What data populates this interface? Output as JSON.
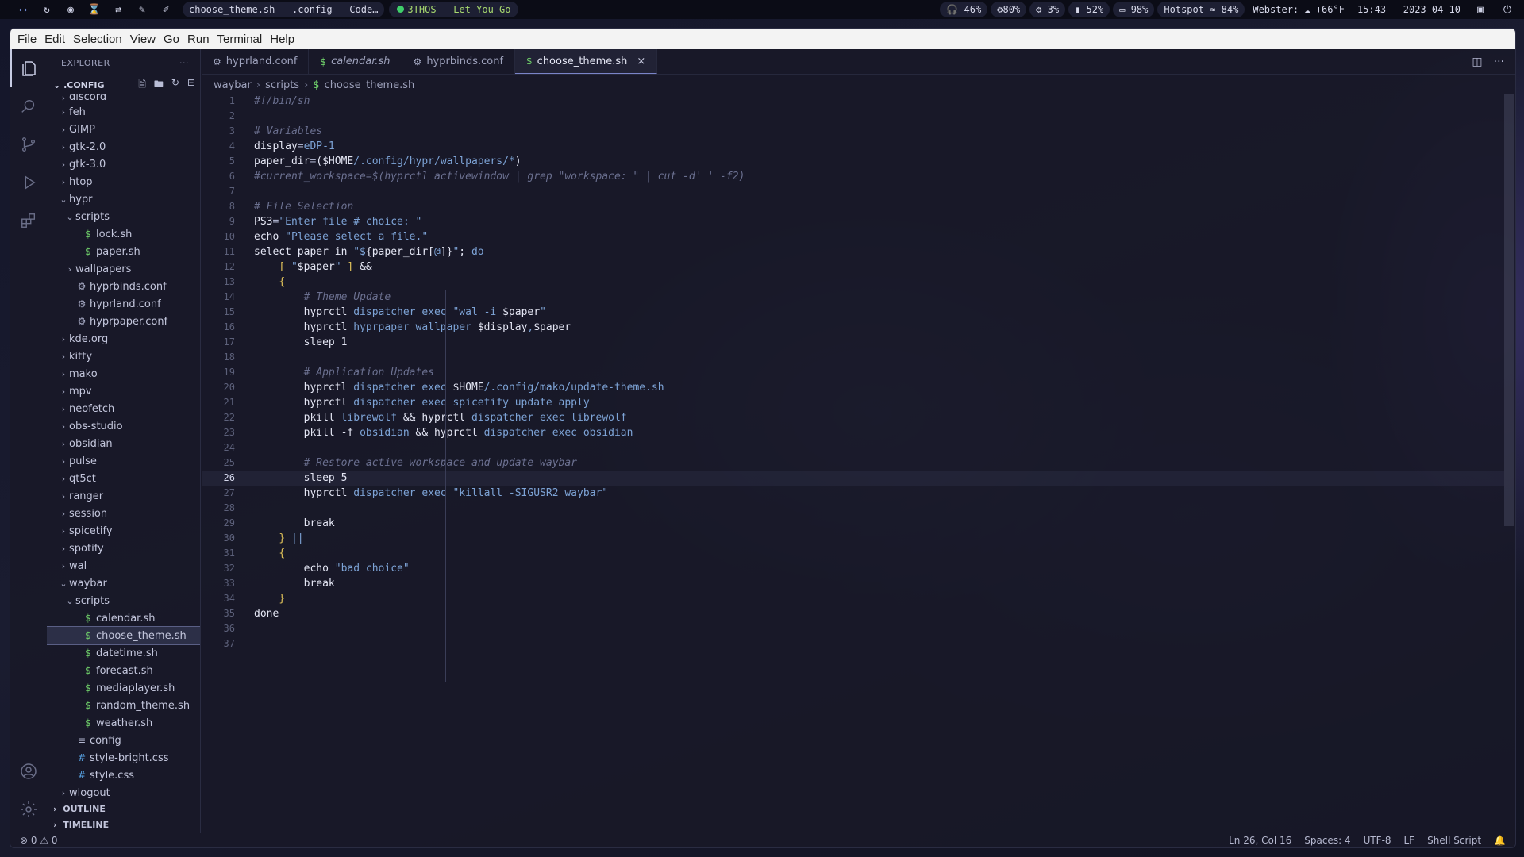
{
  "topbar": {
    "window_title": "choose_theme.sh - .config - Code…",
    "music": "3THOS - Let You Go",
    "pills": [
      "46%",
      "80%",
      "3%",
      "52%",
      "98%"
    ],
    "hotspot": "Hotspot",
    "wifi": "84%",
    "weather": "Webster: ☁ +66°F",
    "datetime": "15:43 - 2023-04-10"
  },
  "menubar": [
    "File",
    "Edit",
    "Selection",
    "View",
    "Go",
    "Run",
    "Terminal",
    "Help"
  ],
  "sidebar": {
    "header": "EXPLORER",
    "more": "···",
    "root": ".CONFIG",
    "items": [
      {
        "label": "discord",
        "depth": 0,
        "kind": "folder",
        "open": false
      },
      {
        "label": "feh",
        "depth": 0,
        "kind": "folder",
        "open": false
      },
      {
        "label": "GIMP",
        "depth": 0,
        "kind": "folder",
        "open": false
      },
      {
        "label": "gtk-2.0",
        "depth": 0,
        "kind": "folder",
        "open": false
      },
      {
        "label": "gtk-3.0",
        "depth": 0,
        "kind": "folder",
        "open": false
      },
      {
        "label": "htop",
        "depth": 0,
        "kind": "folder",
        "open": false
      },
      {
        "label": "hypr",
        "depth": 0,
        "kind": "folder",
        "open": true
      },
      {
        "label": "scripts",
        "depth": 1,
        "kind": "folder",
        "open": true
      },
      {
        "label": "lock.sh",
        "depth": 2,
        "kind": "sh"
      },
      {
        "label": "paper.sh",
        "depth": 2,
        "kind": "sh"
      },
      {
        "label": "wallpapers",
        "depth": 1,
        "kind": "folder",
        "open": false
      },
      {
        "label": "hyprbinds.conf",
        "depth": 1,
        "kind": "conf"
      },
      {
        "label": "hyprland.conf",
        "depth": 1,
        "kind": "conf"
      },
      {
        "label": "hyprpaper.conf",
        "depth": 1,
        "kind": "conf"
      },
      {
        "label": "kde.org",
        "depth": 0,
        "kind": "folder",
        "open": false
      },
      {
        "label": "kitty",
        "depth": 0,
        "kind": "folder",
        "open": false
      },
      {
        "label": "mako",
        "depth": 0,
        "kind": "folder",
        "open": false
      },
      {
        "label": "mpv",
        "depth": 0,
        "kind": "folder",
        "open": false
      },
      {
        "label": "neofetch",
        "depth": 0,
        "kind": "folder",
        "open": false
      },
      {
        "label": "obs-studio",
        "depth": 0,
        "kind": "folder",
        "open": false
      },
      {
        "label": "obsidian",
        "depth": 0,
        "kind": "folder",
        "open": false
      },
      {
        "label": "pulse",
        "depth": 0,
        "kind": "folder",
        "open": false
      },
      {
        "label": "qt5ct",
        "depth": 0,
        "kind": "folder",
        "open": false
      },
      {
        "label": "ranger",
        "depth": 0,
        "kind": "folder",
        "open": false
      },
      {
        "label": "session",
        "depth": 0,
        "kind": "folder",
        "open": false
      },
      {
        "label": "spicetify",
        "depth": 0,
        "kind": "folder",
        "open": false
      },
      {
        "label": "spotify",
        "depth": 0,
        "kind": "folder",
        "open": false
      },
      {
        "label": "wal",
        "depth": 0,
        "kind": "folder",
        "open": false
      },
      {
        "label": "waybar",
        "depth": 0,
        "kind": "folder",
        "open": true
      },
      {
        "label": "scripts",
        "depth": 1,
        "kind": "folder",
        "open": true
      },
      {
        "label": "calendar.sh",
        "depth": 2,
        "kind": "sh"
      },
      {
        "label": "choose_theme.sh",
        "depth": 2,
        "kind": "sh",
        "selected": true
      },
      {
        "label": "datetime.sh",
        "depth": 2,
        "kind": "sh"
      },
      {
        "label": "forecast.sh",
        "depth": 2,
        "kind": "sh"
      },
      {
        "label": "mediaplayer.sh",
        "depth": 2,
        "kind": "sh"
      },
      {
        "label": "random_theme.sh",
        "depth": 2,
        "kind": "sh"
      },
      {
        "label": "weather.sh",
        "depth": 2,
        "kind": "sh"
      },
      {
        "label": "config",
        "depth": 1,
        "kind": "text"
      },
      {
        "label": "style-bright.css",
        "depth": 1,
        "kind": "css"
      },
      {
        "label": "style.css",
        "depth": 1,
        "kind": "css"
      },
      {
        "label": "wlogout",
        "depth": 0,
        "kind": "folder",
        "open": false
      }
    ],
    "outline": "OUTLINE",
    "timeline": "TIMELINE"
  },
  "tabs": [
    {
      "label": "hyprland.conf",
      "icon": "gear",
      "italic": false,
      "active": false
    },
    {
      "label": "calendar.sh",
      "icon": "dollar",
      "italic": true,
      "active": false
    },
    {
      "label": "hyprbinds.conf",
      "icon": "gear",
      "italic": false,
      "active": false
    },
    {
      "label": "choose_theme.sh",
      "icon": "dollar",
      "italic": false,
      "active": true
    }
  ],
  "breadcrumb": [
    "waybar",
    "scripts",
    "choose_theme.sh"
  ],
  "editor": {
    "current_line": 26,
    "lines": [
      [
        [
          "c",
          "#!/bin/sh"
        ]
      ],
      [],
      [
        [
          "c",
          "# Variables"
        ]
      ],
      [
        [
          "t",
          "display"
        ],
        [
          "o",
          "="
        ],
        [
          "s",
          "eDP-1"
        ]
      ],
      [
        [
          "t",
          "paper_dir"
        ],
        [
          "o",
          "="
        ],
        [
          "t",
          "($HOME"
        ],
        [
          "s",
          "/.config/hypr/wallpapers/*"
        ],
        [
          "t",
          ")"
        ]
      ],
      [
        [
          "c",
          "#current_workspace=$(hyprctl activewindow | grep \"workspace: \" | cut -d' ' -f2)"
        ]
      ],
      [],
      [
        [
          "c",
          "# File Selection"
        ]
      ],
      [
        [
          "t",
          "PS3"
        ],
        [
          "o",
          "="
        ],
        [
          "s",
          "\"Enter file # choice: \""
        ]
      ],
      [
        [
          "t",
          "echo "
        ],
        [
          "s",
          "\"Please select a file.\""
        ]
      ],
      [
        [
          "t",
          "select paper in "
        ],
        [
          "s",
          "\"$"
        ],
        [
          "t",
          "{paper_dir["
        ],
        [
          "s",
          "@"
        ],
        [
          "t",
          "]}"
        ],
        [
          "s",
          "\""
        ],
        [
          "t",
          "; "
        ],
        [
          "s",
          "do"
        ]
      ],
      [
        [
          "t",
          "    "
        ],
        [
          "b",
          "["
        ],
        [
          "t",
          " "
        ],
        [
          "s",
          "\""
        ],
        [
          "t",
          "$paper"
        ],
        [
          "s",
          "\""
        ],
        [
          "t",
          " "
        ],
        [
          "b",
          "]"
        ],
        [
          "t",
          " &&"
        ]
      ],
      [
        [
          "t",
          "    "
        ],
        [
          "b",
          "{"
        ]
      ],
      [
        [
          "t",
          "        "
        ],
        [
          "c",
          "# Theme Update"
        ]
      ],
      [
        [
          "t",
          "        hyprctl "
        ],
        [
          "s",
          "dispatcher exec "
        ],
        [
          "s",
          "\"wal -i "
        ],
        [
          "t",
          "$paper"
        ],
        [
          "s",
          "\""
        ]
      ],
      [
        [
          "t",
          "        hyprctl "
        ],
        [
          "s",
          "hyprpaper wallpaper "
        ],
        [
          "t",
          "$display"
        ],
        [
          "s",
          ","
        ],
        [
          "t",
          "$paper"
        ]
      ],
      [
        [
          "t",
          "        sleep 1"
        ]
      ],
      [],
      [
        [
          "t",
          "        "
        ],
        [
          "c",
          "# Application Updates"
        ]
      ],
      [
        [
          "t",
          "        hyprctl "
        ],
        [
          "s",
          "dispatcher exec "
        ],
        [
          "t",
          "$HOME"
        ],
        [
          "s",
          "/.config/mako/update-theme.sh"
        ]
      ],
      [
        [
          "t",
          "        hyprctl "
        ],
        [
          "s",
          "dispatcher exec spicetify update apply"
        ]
      ],
      [
        [
          "t",
          "        pkill "
        ],
        [
          "s",
          "librewolf"
        ],
        [
          "t",
          " && hyprctl "
        ],
        [
          "s",
          "dispatcher exec librewolf"
        ]
      ],
      [
        [
          "t",
          "        pkill -f "
        ],
        [
          "s",
          "obsidian"
        ],
        [
          "t",
          " && hyprctl "
        ],
        [
          "s",
          "dispatcher exec obsidian"
        ]
      ],
      [],
      [
        [
          "t",
          "        "
        ],
        [
          "c",
          "# Restore active workspace and update waybar"
        ]
      ],
      [
        [
          "t",
          "        sleep 5"
        ]
      ],
      [
        [
          "t",
          "        hyprctl "
        ],
        [
          "s",
          "dispatcher exec "
        ],
        [
          "s",
          "\"killall -SIGUSR2 waybar\""
        ]
      ],
      [],
      [
        [
          "t",
          "        break"
        ]
      ],
      [
        [
          "t",
          "    "
        ],
        [
          "b",
          "}"
        ],
        [
          "t",
          " "
        ],
        [
          "s",
          "||"
        ]
      ],
      [
        [
          "t",
          "    "
        ],
        [
          "b",
          "{"
        ]
      ],
      [
        [
          "t",
          "        echo "
        ],
        [
          "s",
          "\"bad choice\""
        ]
      ],
      [
        [
          "t",
          "        break"
        ]
      ],
      [
        [
          "t",
          "    "
        ],
        [
          "b",
          "}"
        ]
      ],
      [
        [
          "t",
          "done"
        ]
      ],
      [],
      []
    ]
  },
  "status": {
    "problems": "⊗ 0 ⚠ 0",
    "cursor": "Ln 26, Col 16",
    "spaces": "Spaces: 4",
    "encoding": "UTF-8",
    "eol": "LF",
    "language": "Shell Script"
  }
}
